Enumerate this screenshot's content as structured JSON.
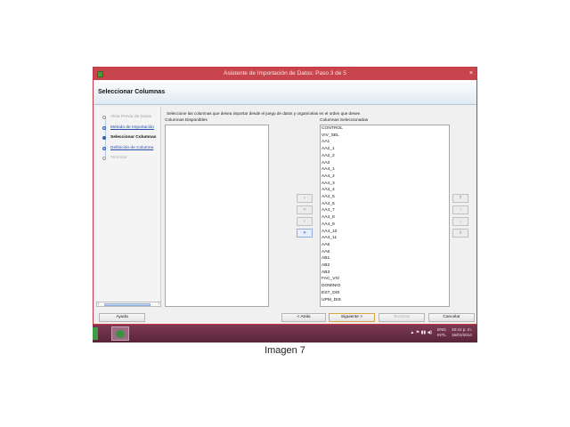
{
  "window": {
    "title": "Asistente de Importación de Datos: Paso 3 de 5",
    "close_glyph": "×",
    "header_title": "Seleccionar Columnas"
  },
  "steps": [
    {
      "label": "Vista Previa de Datos",
      "state": "done"
    },
    {
      "label": "Método de Importación",
      "state": "link"
    },
    {
      "label": "Seleccionar Columnas",
      "state": "current"
    },
    {
      "label": "Definición de Columna",
      "state": "link"
    },
    {
      "label": "Terminar",
      "state": "pending"
    }
  ],
  "instructions": "Seleccione las columnas que desea importar desde el juego de datos y organícelas en el orden que desee.",
  "available": {
    "label": "Columnas Disponibles",
    "items": []
  },
  "selected": {
    "label": "Columnas Seleccionadas",
    "items": [
      "CONTROL",
      "VIV_SEL",
      "AA1",
      "AA2_1",
      "AA2_2",
      "AA3",
      "AA4_1",
      "AA4_2",
      "AA4_3",
      "AA4_4",
      "AA4_5",
      "AA4_6",
      "AA4_7",
      "AA4_8",
      "AA4_9",
      "AA4_10",
      "AA4_11",
      "AA5",
      "AA6",
      "AB1",
      "AB2",
      "AB3",
      "FAC_VIV",
      "DOMINIO",
      "EST_DIS",
      "UPM_DIS"
    ]
  },
  "move_buttons": {
    "add_one": "›",
    "add_all": "»",
    "remove_one": "‹",
    "remove_all": "«"
  },
  "order_buttons": {
    "top": "⇑",
    "up": "↑",
    "down": "↓",
    "bottom": "⇓"
  },
  "footer": {
    "help": "Ayuda",
    "back": "< Atrás",
    "next": "Siguiente >",
    "finish": "Terminar",
    "cancel": "Cancelar"
  },
  "taskbar": {
    "language": "ENG",
    "layout": "INTL",
    "time": "10:41 p. m.",
    "date": "15/01/2014",
    "tray_icons": "▲ ⚑ ▮▮ ◀)"
  },
  "caption": "Imagen 7",
  "colors": {
    "title_bar": "#c9454d",
    "taskbar": "#5b2438",
    "accent": "#2c62b8"
  }
}
